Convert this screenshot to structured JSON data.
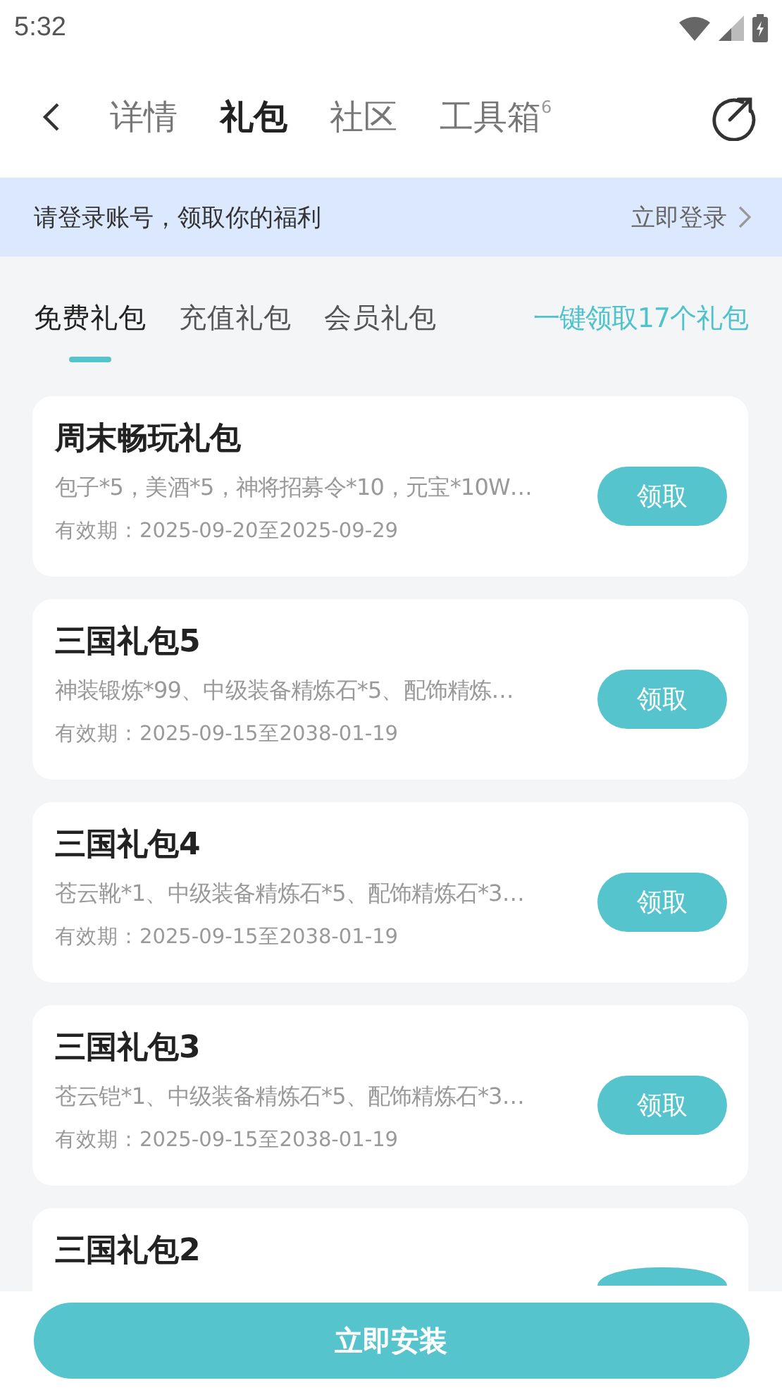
{
  "status_bar": {
    "time": "5:32"
  },
  "nav": {
    "tabs": [
      {
        "label": "详情",
        "selected": false
      },
      {
        "label": "礼包",
        "selected": true
      },
      {
        "label": "社区",
        "selected": false
      },
      {
        "label": "工具箱",
        "badge": "6",
        "selected": false
      }
    ]
  },
  "login_banner": {
    "message": "请登录账号，领取你的福利",
    "action": "立即登录"
  },
  "gift_tabs": [
    {
      "label": "免费礼包",
      "selected": true
    },
    {
      "label": "充值礼包",
      "selected": false
    },
    {
      "label": "会员礼包",
      "selected": false
    }
  ],
  "claim_all": "一键领取17个礼包",
  "gifts": [
    {
      "title": "周末畅玩礼包",
      "contents": "包子*5，美酒*5，神将招募令*10，元宝*10W…",
      "validity": "有效期：2025-09-20至2025-09-29",
      "button": "领取"
    },
    {
      "title": "三国礼包5",
      "contents": "神装锻炼*99、中级装备精炼石*5、配饰精炼…",
      "validity": "有效期：2025-09-15至2038-01-19",
      "button": "领取"
    },
    {
      "title": "三国礼包4",
      "contents": "苍云靴*1、中级装备精炼石*5、配饰精炼石*3…",
      "validity": "有效期：2025-09-15至2038-01-19",
      "button": "领取"
    },
    {
      "title": "三国礼包3",
      "contents": "苍云铠*1、中级装备精炼石*5、配饰精炼石*3…",
      "validity": "有效期：2025-09-15至2038-01-19",
      "button": "领取"
    },
    {
      "title": "三国礼包2"
    }
  ],
  "install_button": "立即安装"
}
